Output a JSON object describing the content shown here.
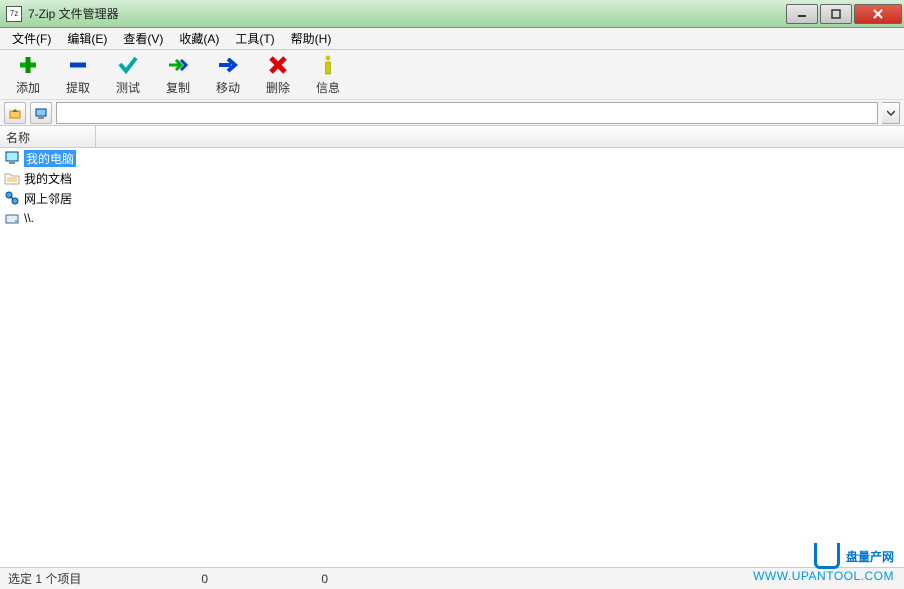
{
  "window": {
    "title": "7-Zip 文件管理器",
    "app_icon_label": "7z"
  },
  "menu": {
    "file": "文件(F)",
    "edit": "编辑(E)",
    "view": "查看(V)",
    "favorites": "收藏(A)",
    "tools": "工具(T)",
    "help": "帮助(H)"
  },
  "toolbar": {
    "add": "添加",
    "extract": "提取",
    "test": "测试",
    "copy": "复制",
    "move": "移动",
    "delete": "删除",
    "info": "信息"
  },
  "pathbar": {
    "value": ""
  },
  "columns": {
    "name": "名称"
  },
  "items": [
    {
      "label": "我的电脑",
      "icon": "computer-icon",
      "selected": true
    },
    {
      "label": "我的文档",
      "icon": "folder-icon",
      "selected": false
    },
    {
      "label": "网上邻居",
      "icon": "network-icon",
      "selected": false
    },
    {
      "label": "\\\\.",
      "icon": "drive-icon",
      "selected": false
    }
  ],
  "status": {
    "selected_text": "选定 1 个项目",
    "val1": "0",
    "val2": "0"
  },
  "watermark": {
    "main": "盘量产网",
    "url": "WWW.UPANTOOL.COM"
  }
}
